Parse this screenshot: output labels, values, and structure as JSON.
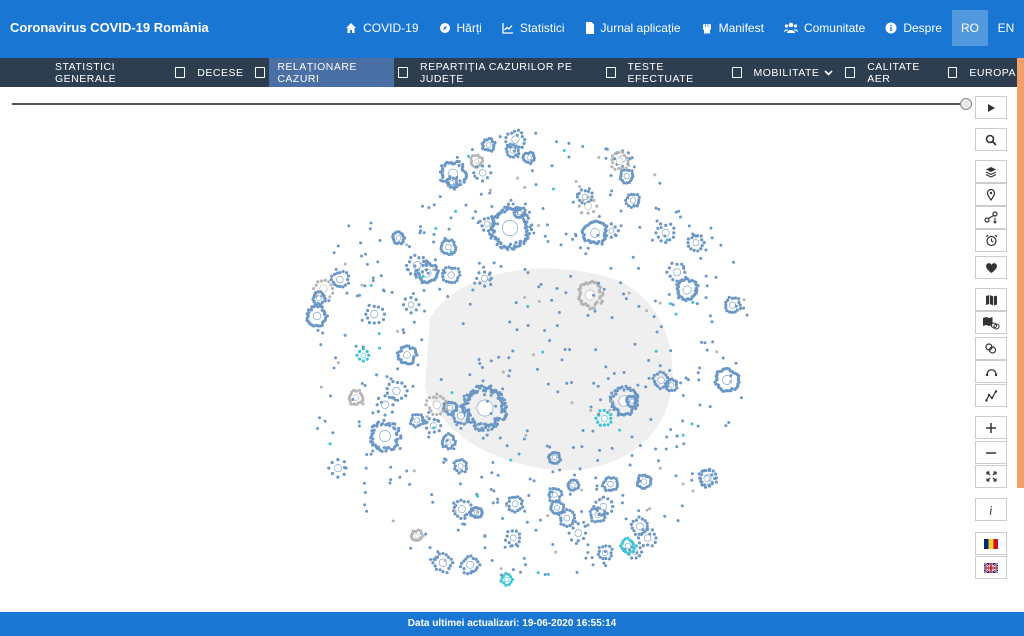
{
  "app": {
    "title": "Coronavirus COVID-19 România"
  },
  "topnav": {
    "items": [
      {
        "label": "COVID-19",
        "icon": "home-icon"
      },
      {
        "label": "Hărți",
        "icon": "compass-icon"
      },
      {
        "label": "Statistici",
        "icon": "chart-icon"
      },
      {
        "label": "Jurnal aplicație",
        "icon": "document-icon"
      },
      {
        "label": "Manifest",
        "icon": "fist-icon"
      },
      {
        "label": "Comunitate",
        "icon": "users-icon"
      },
      {
        "label": "Despre",
        "icon": "info-icon"
      }
    ],
    "languages": [
      {
        "label": "RO",
        "active": true
      },
      {
        "label": "EN",
        "active": false
      }
    ]
  },
  "subnav": {
    "tabs": [
      {
        "label": "STATISTICI GENERALE"
      },
      {
        "label": "DECESE"
      },
      {
        "label": "RELAȚIONARE CAZURI",
        "active": true
      },
      {
        "label": "REPARTIȚIA CAZURILOR PE JUDEȚE"
      },
      {
        "label": "TESTE EFECTUATE"
      },
      {
        "label": "MOBILITATE"
      },
      {
        "label": "CALITATE AER"
      },
      {
        "label": "EUROPA"
      }
    ]
  },
  "footer": {
    "text": "Data ultimei actualizari: 19-06-2020 16:55:14"
  },
  "colors": {
    "primary": "#1976d2",
    "subnav": "#2c3e50",
    "active_tab": "#4a6fa5",
    "node": "#6b97c7",
    "node_highlight": "#3fc3d6",
    "node_grey": "#b5b5b5",
    "scroll_accent": "#f3a06a"
  },
  "toolbar": {
    "buttons": [
      {
        "icon": "play-icon"
      },
      {
        "icon": "search-icon"
      },
      {
        "icon": "layers-icon"
      },
      {
        "icon": "map-pin-icon"
      },
      {
        "icon": "route-icon"
      },
      {
        "icon": "alarm-clock-icon"
      },
      {
        "icon": "heart-icon"
      },
      {
        "icon": "map-icon"
      },
      {
        "icon": "map-link-icon"
      },
      {
        "icon": "link-icon"
      },
      {
        "icon": "arc-icon"
      },
      {
        "icon": "line-graph-icon"
      },
      {
        "icon": "zoom-in-icon"
      },
      {
        "icon": "zoom-out-icon"
      },
      {
        "icon": "fit-screen-icon"
      },
      {
        "icon": "info-icon"
      },
      {
        "icon": "romania-flag-icon"
      },
      {
        "icon": "uk-flag-icon"
      }
    ]
  }
}
